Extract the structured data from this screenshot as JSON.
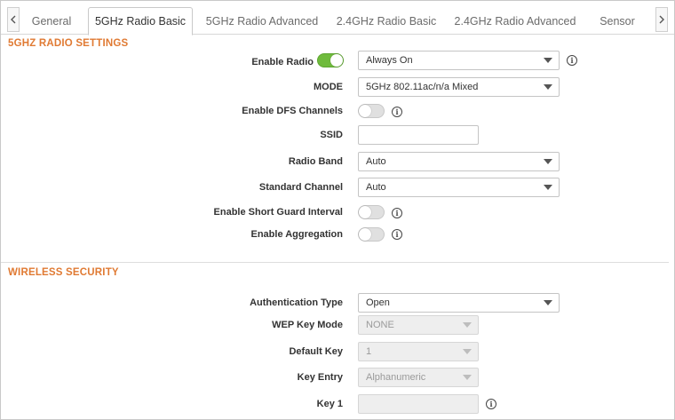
{
  "tabs": [
    "General",
    "5GHz Radio Basic",
    "5GHz Radio Advanced",
    "2.4GHz Radio Basic",
    "2.4GHz Radio Advanced",
    "Sensor"
  ],
  "active_tab": "5GHz Radio Basic",
  "radio_section": {
    "title": "5GHZ RADIO SETTINGS",
    "enable_radio": {
      "label": "Enable Radio",
      "on": true,
      "schedule_value": "Always On"
    },
    "mode": {
      "label": "MODE",
      "value": "5GHz 802.11ac/n/a Mixed"
    },
    "enable_dfs": {
      "label": "Enable DFS Channels",
      "on": false
    },
    "ssid": {
      "label": "SSID",
      "value": ""
    },
    "radio_band": {
      "label": "Radio Band",
      "value": "Auto"
    },
    "standard_channel": {
      "label": "Standard Channel",
      "value": "Auto"
    },
    "short_guard": {
      "label": "Enable Short Guard Interval",
      "on": false
    },
    "aggregation": {
      "label": "Enable Aggregation",
      "on": false
    }
  },
  "security_section": {
    "title": "WIRELESS SECURITY",
    "auth_type": {
      "label": "Authentication Type",
      "value": "Open"
    },
    "wep_key_mode": {
      "label": "WEP Key Mode",
      "value": "NONE"
    },
    "default_key": {
      "label": "Default Key",
      "value": "1"
    },
    "key_entry": {
      "label": "Key Entry",
      "value": "Alphanumeric"
    },
    "key1": {
      "label": "Key 1",
      "value": ""
    }
  },
  "info_glyph": "i",
  "colors": {
    "accent": "#e07a33",
    "toggle_on": "#6fbb3c"
  }
}
